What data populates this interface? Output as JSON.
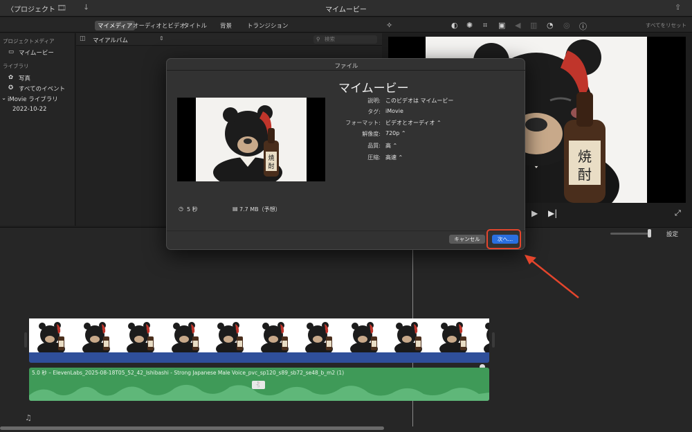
{
  "titlebar": {
    "back_label": "〈プロジェクト",
    "title": "マイムービー"
  },
  "media_tabs": [
    "マイメディア",
    "オーディオとビデオ",
    "タイトル",
    "背景",
    "トランジション"
  ],
  "viewer_toolbar": {
    "reset_all": "すべてをリセット"
  },
  "sidebar": {
    "project_media_heading": "プロジェクトメディア",
    "project_item": "マイムービー",
    "library_heading": "ライブラリ",
    "photos": "写真",
    "all_events": "すべてのイベント",
    "imovie_library": "iMovie ライブラリ",
    "date": "2022-10-22"
  },
  "browser": {
    "album_label": "マイアルバム",
    "search_placeholder": "検索"
  },
  "dialog": {
    "window_title": "ファイル",
    "title": "マイムービー",
    "rows": [
      {
        "label": "説明:",
        "value": "このビデオは マイムービー"
      },
      {
        "label": "タグ:",
        "value": "iMovie"
      },
      {
        "label": "フォーマット:",
        "value": "ビデオとオーディオ ⌃"
      },
      {
        "label": "解像度:",
        "value": "720p ⌃"
      },
      {
        "label": "品質:",
        "value": "高 ⌃"
      },
      {
        "label": "圧縮:",
        "value": "高速 ⌃"
      }
    ],
    "duration": "5 秒",
    "size": "7.7 MB（予想）",
    "cancel_label": "キャンセル",
    "next_label": "次へ..."
  },
  "timeline": {
    "settings_label": "設定",
    "audio_clip_label": "5.0 秒 – ElevenLabs_2025-08-18T05_52_42_Ishibashi - Strong Japanese Male Voice_pvc_sp120_s89_sb72_se48_b_m2 (1)"
  },
  "artwork_text": {
    "bottle_label": "焼酎"
  },
  "colors": {
    "accent_blue": "#2a6fe0",
    "annotation_red": "#e4452c",
    "audio_green": "#3f9a58",
    "clip_blue": "#2f4f9a"
  }
}
